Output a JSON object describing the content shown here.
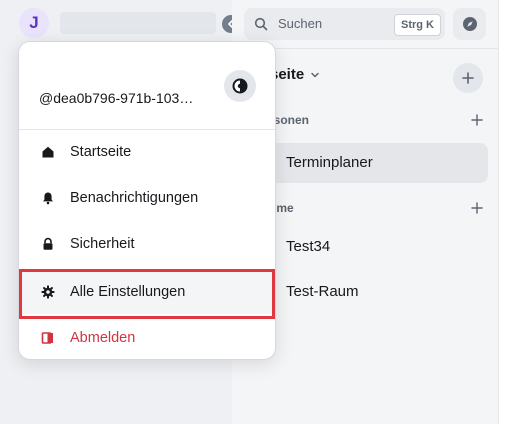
{
  "sidebar": {
    "avatar_letter": "J"
  },
  "search": {
    "placeholder": "Suchen",
    "shortcut": "Strg K"
  },
  "home": {
    "title": "tseite"
  },
  "sections": [
    {
      "title": "rsonen",
      "rooms": [
        "Terminplaner"
      ]
    },
    {
      "title": "ume",
      "rooms": [
        "Test34",
        "Test-Raum"
      ]
    }
  ],
  "menu": {
    "user_id": "@dea0b796-971b-103…",
    "items": [
      {
        "label": "Startseite",
        "icon": "home-icon"
      },
      {
        "label": "Benachrichtigungen",
        "icon": "bell-icon"
      },
      {
        "label": "Sicherheit",
        "icon": "lock-icon"
      },
      {
        "label": "Alle Einstellungen",
        "icon": "gear-icon"
      },
      {
        "label": "Abmelden",
        "icon": "sign-out-icon"
      }
    ]
  },
  "colors": {
    "accent": "#5b35c9",
    "danger": "#d0353f",
    "focus_ring": "#e0383e"
  }
}
